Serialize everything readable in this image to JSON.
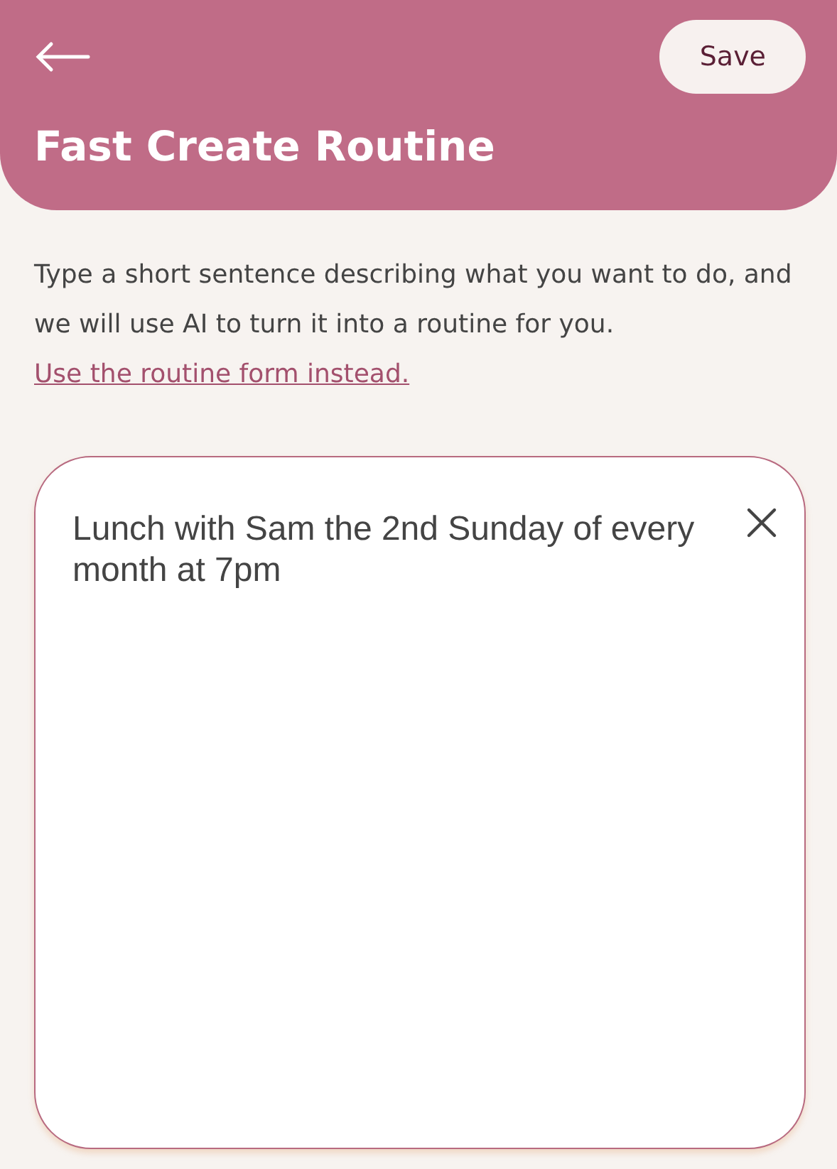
{
  "header": {
    "save_button": "Save",
    "title": "Fast Create Routine"
  },
  "intro": {
    "text": "Type a short sentence describing what you want to do, and we will use AI to turn it into a routine for you.",
    "link": "Use the routine form instead."
  },
  "sentence_field": {
    "value": "Lunch with Sam the 2nd Sunday of every month at 7pm"
  }
}
